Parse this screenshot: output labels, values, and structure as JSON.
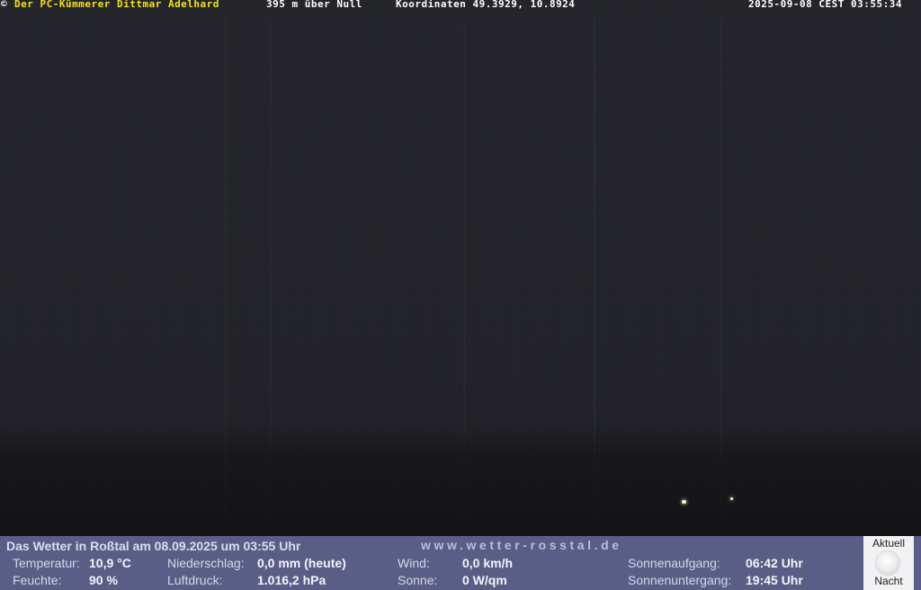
{
  "overlay": {
    "copyright": "©",
    "author": "Der PC-Kümmerer Dittmar Adelhard",
    "altitude": "395 m über Null",
    "coordinates": "Koordinaten 49.3929, 10.8924",
    "timestamp": "2025-09-08 CEST 03:55:34"
  },
  "weather": {
    "title": "Das Wetter in Roßtal am 08.09.2025 um 03:55 Uhr",
    "website": "www.wetter-rosstal.de",
    "temperature": {
      "label": "Temperatur:",
      "value": "10,9 °C"
    },
    "humidity": {
      "label": "Feuchte:",
      "value": "90 %"
    },
    "precipitation": {
      "label": "Niederschlag:",
      "value": "0,0 mm (heute)"
    },
    "pressure": {
      "label": "Luftdruck:",
      "value": "1.016,2 hPa"
    },
    "wind": {
      "label": "Wind:",
      "value": "0,0 km/h"
    },
    "sun": {
      "label": "Sonne:",
      "value": "0 W/qm"
    },
    "sunrise": {
      "label": "Sonnenaufgang:",
      "value": "06:42 Uhr"
    },
    "sunset": {
      "label": "Sonnenuntergang:",
      "value": "19:45 Uhr"
    }
  },
  "moon": {
    "top_label": "Aktuell",
    "bottom_label": "Nacht",
    "icon": "moon-icon"
  },
  "colors": {
    "panel": "#5a5e87",
    "author_text": "#f2e21a"
  }
}
